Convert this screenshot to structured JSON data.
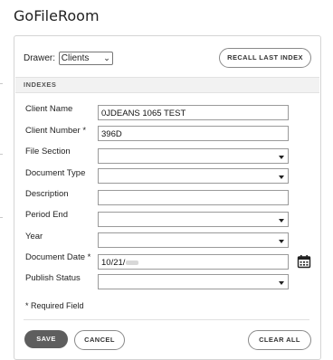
{
  "app": {
    "title": "GoFileRoom"
  },
  "drawer": {
    "label": "Drawer:",
    "selected": "Clients"
  },
  "buttons": {
    "recall_last_index": "RECALL LAST INDEX",
    "save": "SAVE",
    "cancel": "CANCEL",
    "clear_all": "CLEAR ALL"
  },
  "section": {
    "indexes": "INDEXES"
  },
  "fields": [
    {
      "label": "Client Name",
      "value": "0JDEANS 1065 TEST",
      "type": "text"
    },
    {
      "label": "Client Number *",
      "value": "396D",
      "type": "text"
    },
    {
      "label": "File Section",
      "value": "",
      "type": "dropdown"
    },
    {
      "label": "Document Type",
      "value": "",
      "type": "dropdown"
    },
    {
      "label": "Description",
      "value": "",
      "type": "text"
    },
    {
      "label": "Period End",
      "value": "",
      "type": "dropdown"
    },
    {
      "label": "Year",
      "value": "",
      "type": "dropdown"
    },
    {
      "label": "Document Date *",
      "value": "10/21/",
      "type": "date"
    },
    {
      "label": "Publish Status",
      "value": "",
      "type": "dropdown"
    }
  ],
  "required_note": "* Required Field",
  "icons": {
    "calendar": "calendar-icon",
    "dropdown": "chevron-down-icon"
  },
  "colors": {
    "save_button_bg": "#5e5e5e",
    "border": "#9a9a9a",
    "section_bg": "#f2f2f2"
  }
}
